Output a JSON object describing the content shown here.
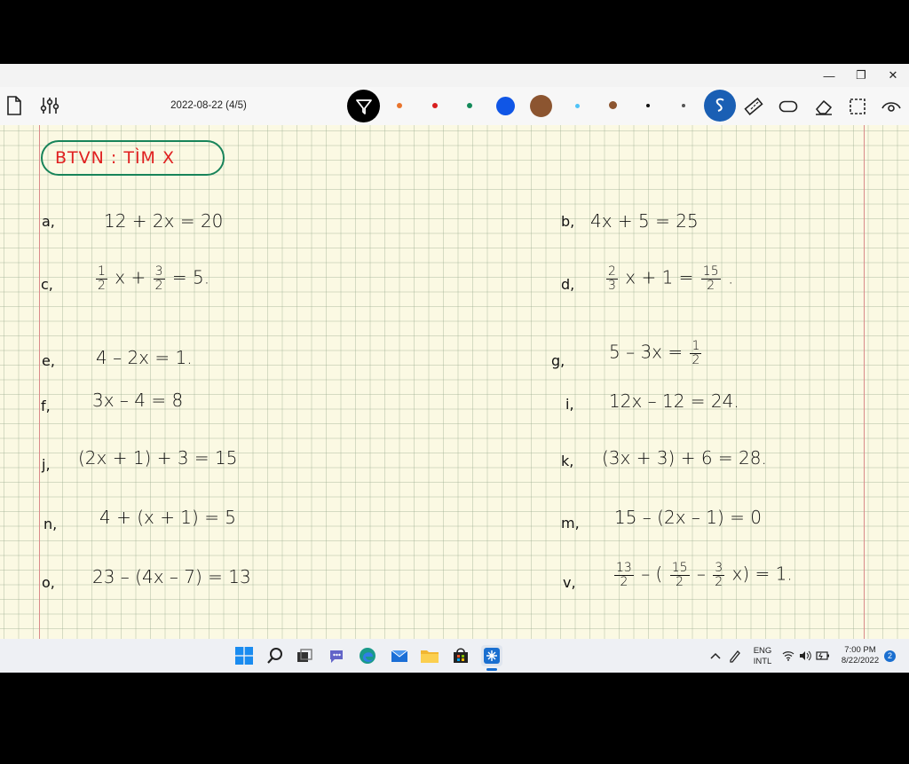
{
  "window": {
    "minimize_label": "—",
    "maximize_label": "❐",
    "close_label": "✕"
  },
  "toolbar": {
    "document_title": "2022-08-22 (4/5)",
    "pen_colors": [
      "#e8742c",
      "#d81e1e",
      "#148a5a",
      "#1056e6",
      "#8c5530",
      "#4fc3f7",
      "#8c5530",
      "#111111",
      "#555555"
    ],
    "icons": [
      "new-page-icon",
      "settings-sliders-icon",
      "funnel-pen-icon",
      "lasso-icon",
      "ruler-icon",
      "shape-icon",
      "eraser-icon",
      "selection-icon",
      "view-icon"
    ]
  },
  "canvas": {
    "badge": {
      "text": "BTVN :   TÌM X"
    },
    "exercises": [
      {
        "label": "a,",
        "parts": [
          "12  +  2x  =  20"
        ]
      },
      {
        "label": "b,",
        "parts": [
          "4x  +  5  =  25"
        ]
      },
      {
        "label": "c,",
        "frac1": [
          "1",
          "2"
        ],
        "mid": "x   +",
        "frac2": [
          "3",
          "2"
        ],
        "tail": "=   5."
      },
      {
        "label": "d,",
        "frac1": [
          "2",
          "3"
        ],
        "mid": "x  +  1  =",
        "frac2": [
          "15",
          "2"
        ],
        "tail": "."
      },
      {
        "label": "e,",
        "parts": [
          "4  –  2x  =  1."
        ]
      },
      {
        "label": "g,",
        "pre": "5  –  3x  =",
        "frac1": [
          "1",
          "2"
        ]
      },
      {
        "label": "f,",
        "parts": [
          "3x  –  4  =  8"
        ]
      },
      {
        "label": "i,",
        "parts": [
          "12x  –  12  =  24."
        ]
      },
      {
        "label": "j,",
        "parts": [
          "(2x + 1)   + 3  = 15"
        ]
      },
      {
        "label": "k,",
        "parts": [
          "(3x + 3)   + 6  =  28."
        ]
      },
      {
        "label": "n,",
        "parts": [
          "4  +  (x + 1)  =  5"
        ]
      },
      {
        "label": "m,",
        "parts": [
          "15 –  (2x – 1)  = 0"
        ]
      },
      {
        "label": "o,",
        "parts": [
          "23 – (4x – 7)  =  13"
        ]
      },
      {
        "label": "v,",
        "frac1": [
          "13",
          "2"
        ],
        "mid": " –  (",
        "frac2": [
          "15",
          "2"
        ],
        "mid2": "–",
        "frac3": [
          "3",
          "2"
        ],
        "tail": "x)   =  1."
      }
    ]
  },
  "taskbar": {
    "apps": [
      "windows-start-icon",
      "search-icon",
      "task-view-icon",
      "teams-chat-icon",
      "edge-icon",
      "mail-icon",
      "file-explorer-icon",
      "store-icon",
      "notes-app-icon"
    ],
    "tray": {
      "language_line1": "ENG",
      "language_line2": "INTL",
      "time": "7:00 PM",
      "date": "8/22/2022",
      "notification_count": "2"
    }
  }
}
